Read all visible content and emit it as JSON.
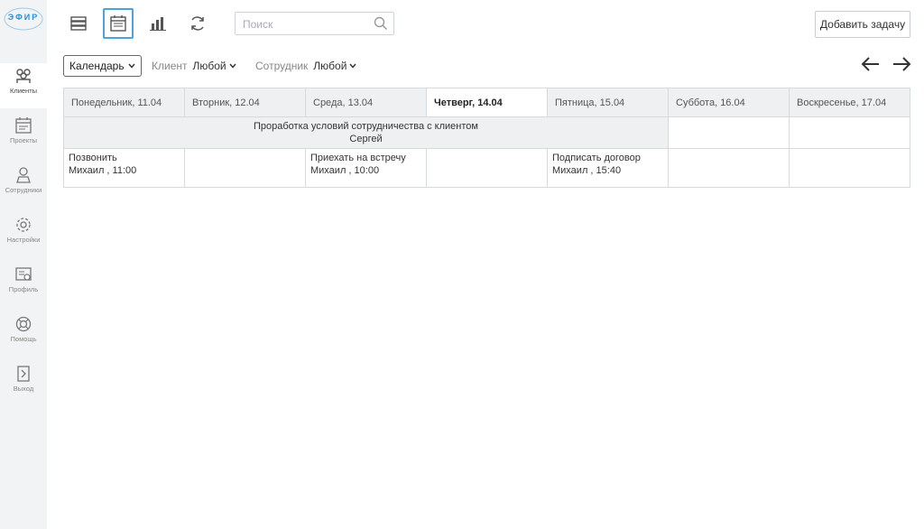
{
  "app": {
    "logo_text": "ЭФИР"
  },
  "sidebar": {
    "items": [
      {
        "label": "Клиенты",
        "icon": "clients-icon"
      },
      {
        "label": "Проекты",
        "icon": "projects-icon"
      },
      {
        "label": "Сотрудники",
        "icon": "employees-icon"
      },
      {
        "label": "Настройки",
        "icon": "settings-icon"
      },
      {
        "label": "Профиль",
        "icon": "profile-icon"
      },
      {
        "label": "Помощь",
        "icon": "help-icon"
      },
      {
        "label": "Выход",
        "icon": "logout-icon"
      }
    ]
  },
  "toolbar": {
    "search_placeholder": "Поиск",
    "add_task_label": "Добавить задачу"
  },
  "filters": {
    "view_label": "Календарь",
    "client_label": "Клиент",
    "client_value": "Любой",
    "employee_label": "Сотрудник",
    "employee_value": "Любой"
  },
  "calendar": {
    "days": [
      "Понедельник, 11.04",
      "Вторник, 12.04",
      "Среда, 13.04",
      "Четверг, 14.04",
      "Пятница, 15.04",
      "Суббота, 16.04",
      "Воскресенье, 17.04"
    ],
    "today_index": 3,
    "span_task": {
      "title": "Проработка условий сотрудничества с клиентом",
      "person": "Сергей"
    },
    "tasks": [
      {
        "title": "Позвонить",
        "meta": "Михаил , 11:00"
      },
      {
        "title": "Приехать на встречу",
        "meta": "Михаил , 10:00"
      },
      {
        "title": "Подписать договор",
        "meta": "Михаил , 15:40"
      }
    ]
  },
  "colors": {
    "accent": "#4aa3df",
    "header_bg": "#eef0f2",
    "sidebar_bg": "#f2f3f4"
  }
}
